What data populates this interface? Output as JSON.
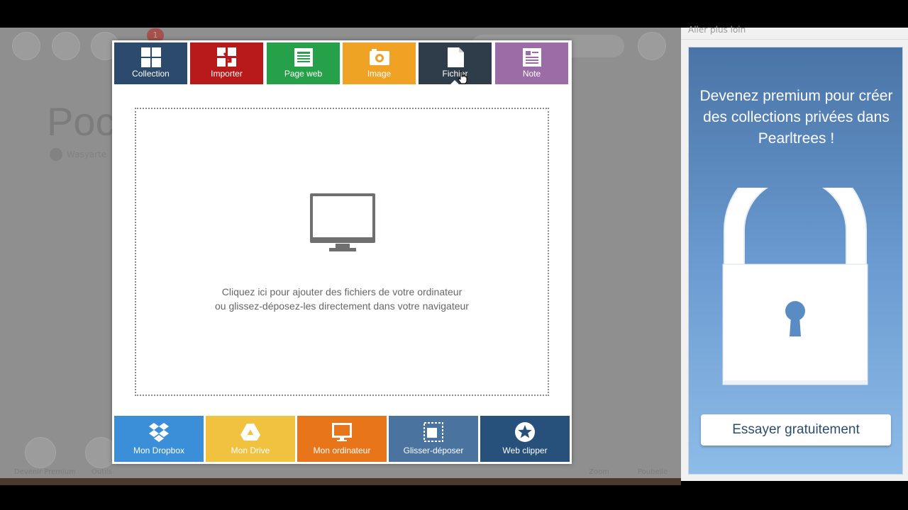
{
  "background_app": {
    "title_partial": "Poc",
    "subtitle_partial": "Wasyarte",
    "notification_count": "1",
    "bottom_labels": [
      "Devenir Premium",
      "Outils",
      "Zoom",
      "Poubelle"
    ]
  },
  "right_panel": {
    "go_further": "Aller plus loin",
    "promo_text": "Devenez premium pour créer des collections privées dans Pearltrees !",
    "try_button": "Essayer gratuitement"
  },
  "modal": {
    "tabs": [
      {
        "label": "Collection",
        "color": "#2c4a6b",
        "icon": "collection-icon"
      },
      {
        "label": "Importer",
        "color": "#b8191a",
        "icon": "import-icon"
      },
      {
        "label": "Page web",
        "color": "#27a04a",
        "icon": "webpage-icon"
      },
      {
        "label": "Image",
        "color": "#f0a224",
        "icon": "image-icon"
      },
      {
        "label": "Fichier",
        "color": "#2f3d4a",
        "icon": "file-icon",
        "active": true
      },
      {
        "label": "Note",
        "color": "#9b6ca6",
        "icon": "note-icon"
      }
    ],
    "dropzone": {
      "line1": "Cliquez ici pour ajouter des fichiers de votre ordinateur",
      "line2": "ou glissez-déposez-les directement dans votre navigateur"
    },
    "sources": [
      {
        "label": "Mon Dropbox",
        "color": "#3b8fd8",
        "icon": "dropbox-icon"
      },
      {
        "label": "Mon Drive",
        "color": "#f0c240",
        "icon": "drive-icon"
      },
      {
        "label": "Mon ordinateur",
        "color": "#e8751a",
        "icon": "computer-icon"
      },
      {
        "label": "Glisser-déposer",
        "color": "#4a73a0",
        "icon": "drag-drop-icon"
      },
      {
        "label": "Web clipper",
        "color": "#27507a",
        "icon": "star-icon"
      }
    ]
  }
}
